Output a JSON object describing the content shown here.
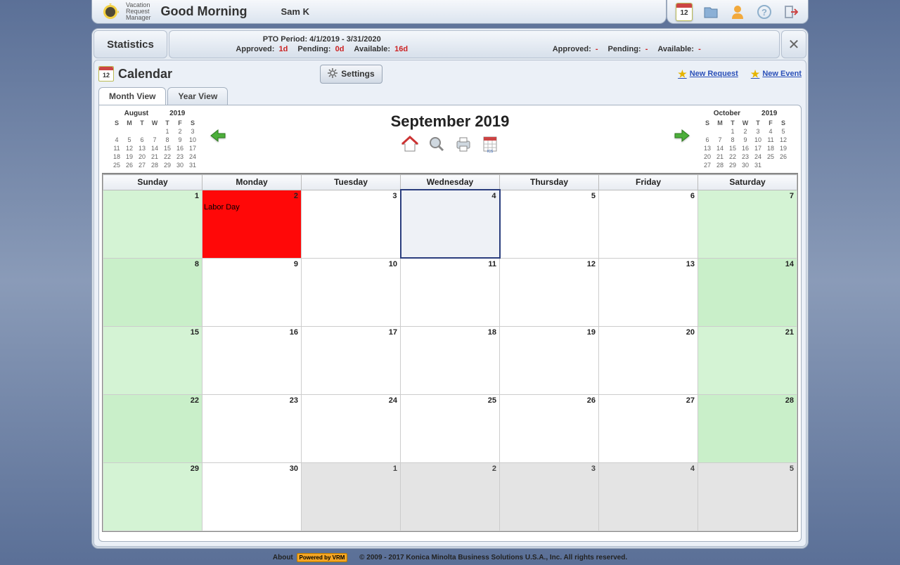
{
  "app": {
    "brand_line1": "Vacation",
    "brand_line2": "Request",
    "brand_line3": "Manager",
    "greeting": "Good Morning",
    "username": "Sam K",
    "cal_badge_num": "12"
  },
  "stats": {
    "label": "Statistics",
    "period_label": "PTO Period: 4/1/2019 - 3/31/2020",
    "left": {
      "approved_label": "Approved:",
      "approved_val": "1d",
      "pending_label": "Pending:",
      "pending_val": "0d",
      "available_label": "Available:",
      "available_val": "16d"
    },
    "right": {
      "approved_label": "Approved:",
      "approved_val": "-",
      "pending_label": "Pending:",
      "pending_val": "-",
      "available_label": "Available:",
      "available_val": "-"
    }
  },
  "panel": {
    "title": "Calendar",
    "settings_label": "Settings",
    "new_request_label": "New Request",
    "new_event_label": "New Event",
    "cal_badge_num": "12"
  },
  "tabs": {
    "month": "Month View",
    "year": "Year View"
  },
  "navigation": {
    "prev_month": "August",
    "prev_year": "2019",
    "next_month": "October",
    "next_year": "2019",
    "current_title": "September 2019"
  },
  "mini_prev": {
    "dow": [
      "S",
      "M",
      "T",
      "W",
      "T",
      "F",
      "S"
    ],
    "rows": [
      [
        "",
        "",
        "",
        "",
        "1",
        "2",
        "3"
      ],
      [
        "4",
        "5",
        "6",
        "7",
        "8",
        "9",
        "10"
      ],
      [
        "11",
        "12",
        "13",
        "14",
        "15",
        "16",
        "17"
      ],
      [
        "18",
        "19",
        "20",
        "21",
        "22",
        "23",
        "24"
      ],
      [
        "25",
        "26",
        "27",
        "28",
        "29",
        "30",
        "31"
      ]
    ]
  },
  "mini_next": {
    "dow": [
      "S",
      "M",
      "T",
      "W",
      "T",
      "F",
      "S"
    ],
    "rows": [
      [
        "",
        "",
        "1",
        "2",
        "3",
        "4",
        "5"
      ],
      [
        "6",
        "7",
        "8",
        "9",
        "10",
        "11",
        "12"
      ],
      [
        "13",
        "14",
        "15",
        "16",
        "17",
        "18",
        "19"
      ],
      [
        "20",
        "21",
        "22",
        "23",
        "24",
        "25",
        "26"
      ],
      [
        "27",
        "28",
        "29",
        "30",
        "31",
        "",
        ""
      ]
    ]
  },
  "grid": {
    "dow": [
      "Sunday",
      "Monday",
      "Tuesday",
      "Wednesday",
      "Thursday",
      "Friday",
      "Saturday"
    ],
    "weeks": [
      [
        {
          "n": "1",
          "cls": "weekend"
        },
        {
          "n": "2",
          "cls": "holiday",
          "event": "Labor Day"
        },
        {
          "n": "3",
          "cls": ""
        },
        {
          "n": "4",
          "cls": "today"
        },
        {
          "n": "5",
          "cls": ""
        },
        {
          "n": "6",
          "cls": ""
        },
        {
          "n": "7",
          "cls": "weekend"
        }
      ],
      [
        {
          "n": "8",
          "cls": "weekend2"
        },
        {
          "n": "9",
          "cls": ""
        },
        {
          "n": "10",
          "cls": ""
        },
        {
          "n": "11",
          "cls": ""
        },
        {
          "n": "12",
          "cls": ""
        },
        {
          "n": "13",
          "cls": ""
        },
        {
          "n": "14",
          "cls": "weekend2"
        }
      ],
      [
        {
          "n": "15",
          "cls": "weekend"
        },
        {
          "n": "16",
          "cls": ""
        },
        {
          "n": "17",
          "cls": ""
        },
        {
          "n": "18",
          "cls": ""
        },
        {
          "n": "19",
          "cls": ""
        },
        {
          "n": "20",
          "cls": ""
        },
        {
          "n": "21",
          "cls": "weekend"
        }
      ],
      [
        {
          "n": "22",
          "cls": "weekend2"
        },
        {
          "n": "23",
          "cls": ""
        },
        {
          "n": "24",
          "cls": ""
        },
        {
          "n": "25",
          "cls": ""
        },
        {
          "n": "26",
          "cls": ""
        },
        {
          "n": "27",
          "cls": ""
        },
        {
          "n": "28",
          "cls": "weekend2"
        }
      ],
      [
        {
          "n": "29",
          "cls": "weekend"
        },
        {
          "n": "30",
          "cls": ""
        },
        {
          "n": "1",
          "cls": "other-month"
        },
        {
          "n": "2",
          "cls": "other-month"
        },
        {
          "n": "3",
          "cls": "other-month"
        },
        {
          "n": "4",
          "cls": "other-month"
        },
        {
          "n": "5",
          "cls": "weekend other-month"
        }
      ]
    ]
  },
  "footer": {
    "about_label": "About",
    "powered": "Powered by VRM",
    "copyright": "© 2009 - 2017 Konica Minolta Business Solutions U.S.A., Inc. All rights reserved."
  }
}
